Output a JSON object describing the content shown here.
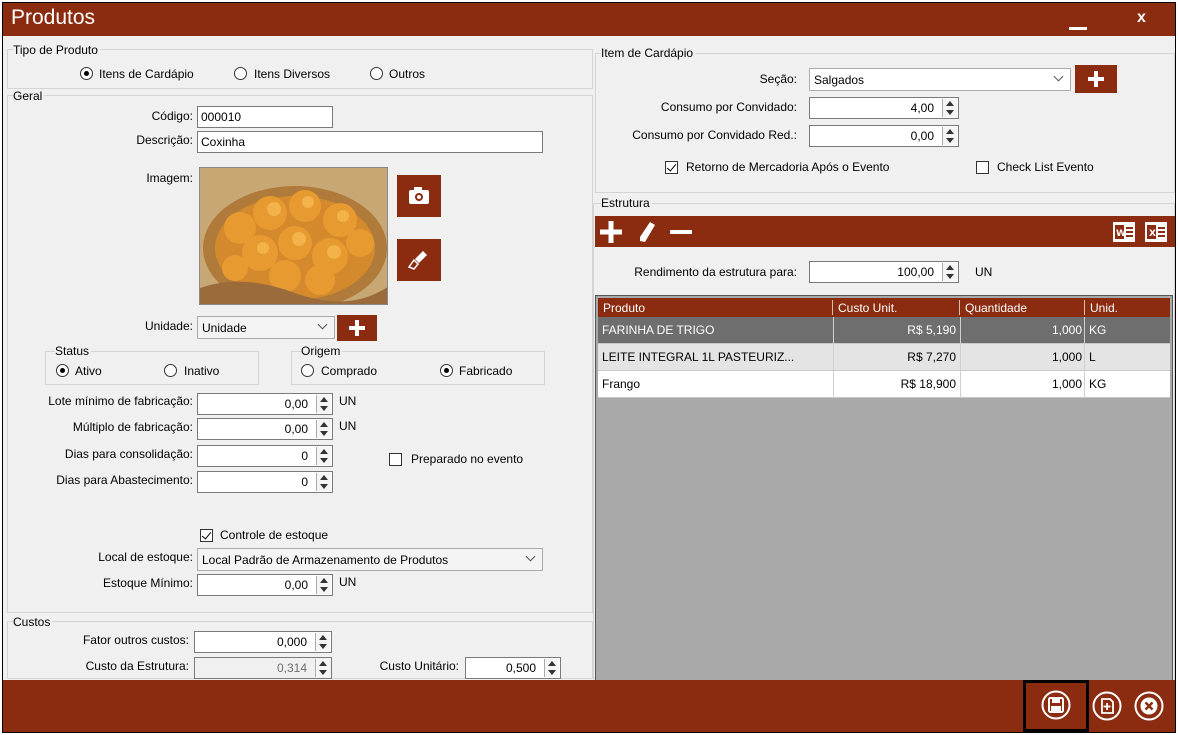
{
  "window": {
    "title": "Produtos",
    "close_label": "x"
  },
  "tipo_produto": {
    "legend": "Tipo de Produto",
    "options": [
      "Itens de Cardápio",
      "Itens Diversos",
      "Outros"
    ],
    "selected_index": 0
  },
  "geral": {
    "legend": "Geral",
    "codigo_label": "Código:",
    "codigo_value": "000010",
    "descricao_label": "Descrição:",
    "descricao_value": "Coxinha",
    "imagem_label": "Imagem:",
    "unidade_label": "Unidade:",
    "unidade_value": "Unidade"
  },
  "status": {
    "legend": "Status",
    "ativo": "Ativo",
    "inativo": "Inativo",
    "selected": "Ativo"
  },
  "origem": {
    "legend": "Origem",
    "comprado": "Comprado",
    "fabricado": "Fabricado",
    "selected": "Fabricado"
  },
  "fabricacao": {
    "lote_label": "Lote mínimo de fabricação:",
    "lote_value": "0,00",
    "lote_unit": "UN",
    "multiplo_label": "Múltiplo de fabricação:",
    "multiplo_value": "0,00",
    "multiplo_unit": "UN",
    "consolidacao_label": "Dias para consolidação:",
    "consolidacao_value": "0",
    "abastecimento_label": "Dias para Abastecimento:",
    "abastecimento_value": "0",
    "preparado_label": "Preparado no evento",
    "preparado_checked": false
  },
  "estoque": {
    "controle_label": "Controle de estoque",
    "controle_checked": true,
    "local_label": "Local de estoque:",
    "local_value": "Local Padrão de Armazenamento de Produtos",
    "minimo_label": "Estoque Mínimo:",
    "minimo_value": "0,00",
    "minimo_unit": "UN"
  },
  "custos": {
    "legend": "Custos",
    "fator_label": "Fator outros custos:",
    "fator_value": "0,000",
    "estrutura_label": "Custo da Estrutura:",
    "estrutura_value": "0,314",
    "unitario_label": "Custo Unitário:",
    "unitario_value": "0,500"
  },
  "item_cardapio": {
    "legend": "Item de Cardápio",
    "secao_label": "Seção:",
    "secao_value": "Salgados",
    "consumo_label": "Consumo por Convidado:",
    "consumo_value": "4,00",
    "consumo_red_label": "Consumo por Convidado Red.:",
    "consumo_red_value": "0,00",
    "retorno_label": "Retorno de Mercadoria Após o Evento",
    "retorno_checked": true,
    "checklist_label": "Check List Evento",
    "checklist_checked": false
  },
  "estrutura": {
    "legend": "Estrutura",
    "rendimento_label": "Rendimento da estrutura para:",
    "rendimento_value": "100,00",
    "rendimento_unit": "UN",
    "columns": [
      "Produto",
      "Custo Unit.",
      "Quantidade",
      "Unid."
    ],
    "rows": [
      {
        "produto": "FARINHA DE TRIGO",
        "custo": "R$ 5,190",
        "quantidade": "1,000",
        "unid": "KG"
      },
      {
        "produto": "LEITE INTEGRAL 1L PASTEURIZ...",
        "custo": "R$ 7,270",
        "quantidade": "1,000",
        "unid": "L"
      },
      {
        "produto": "Frango",
        "custo": "R$ 18,900",
        "quantidade": "1,000",
        "unid": "KG"
      }
    ]
  },
  "icons": {
    "toolbar": [
      "add-icon",
      "edit-icon",
      "remove-icon",
      "word-export-icon",
      "excel-export-icon"
    ],
    "footer": [
      "save-icon",
      "new-icon",
      "cancel-icon"
    ],
    "image_buttons": [
      "camera-icon",
      "clear-image-icon"
    ]
  },
  "colors": {
    "accent": "#8b2b10",
    "grid_background": "#a9a9a9",
    "selected_row": "#6e6e6e"
  }
}
